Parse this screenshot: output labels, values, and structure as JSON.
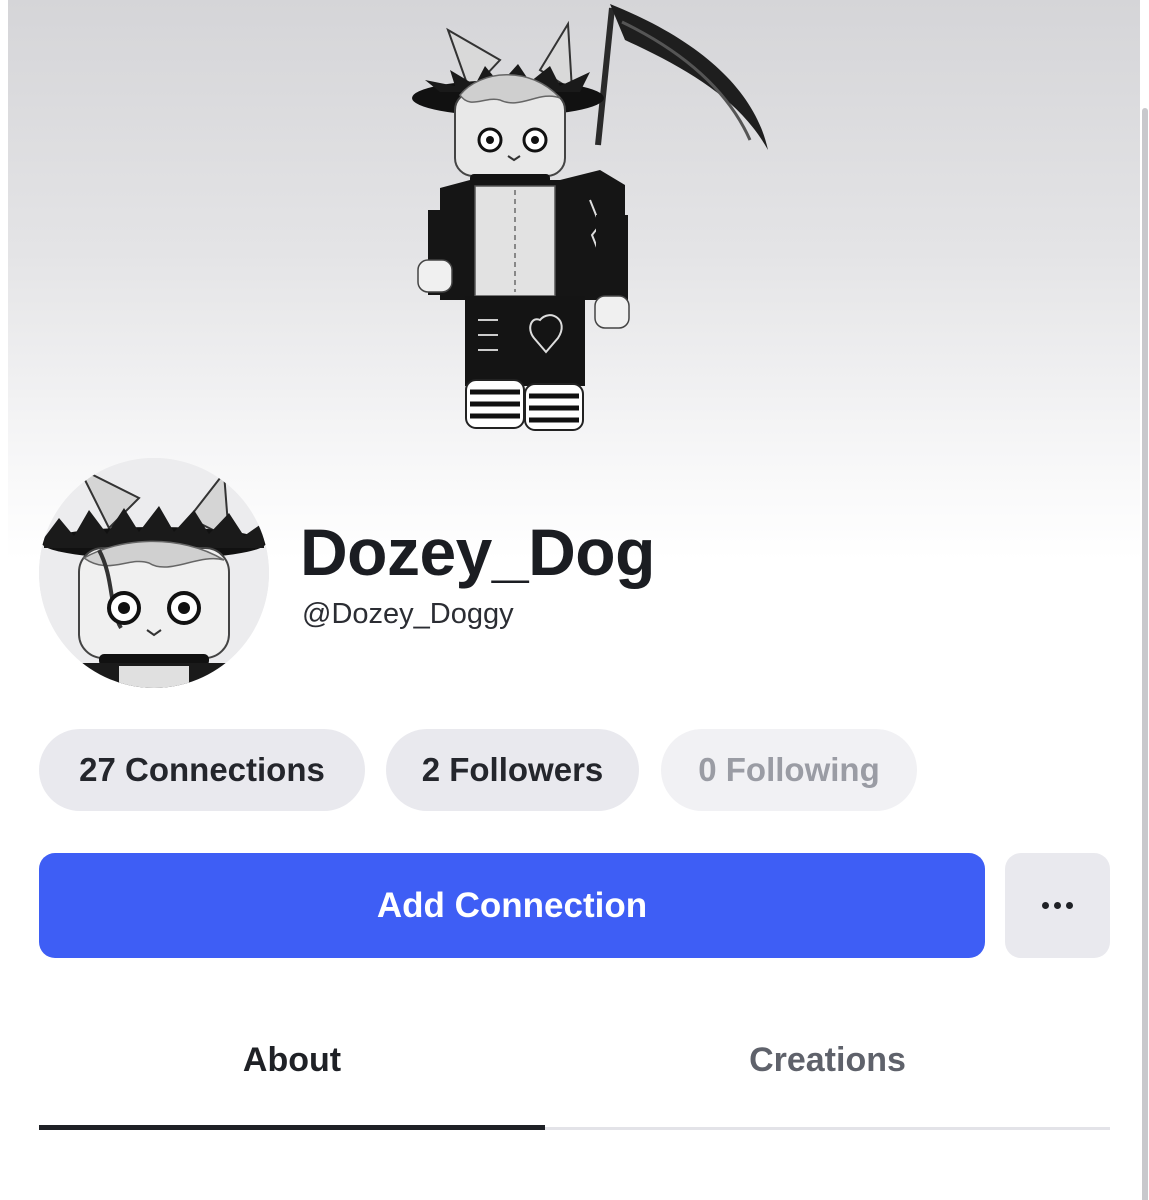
{
  "profile": {
    "display_name": "Dozey_Dog",
    "username": "@Dozey_Doggy"
  },
  "stats": {
    "connections": "27 Connections",
    "followers": "2 Followers",
    "following": "0 Following"
  },
  "actions": {
    "add_connection": "Add Connection",
    "more_icon": "ellipsis-icon"
  },
  "tabs": [
    {
      "label": "About",
      "active": true
    },
    {
      "label": "Creations",
      "active": false
    }
  ],
  "colors": {
    "primary_button": "#3e5ef5",
    "pill_bg": "#e9e9ee",
    "muted_text": "#9a9ca4"
  }
}
